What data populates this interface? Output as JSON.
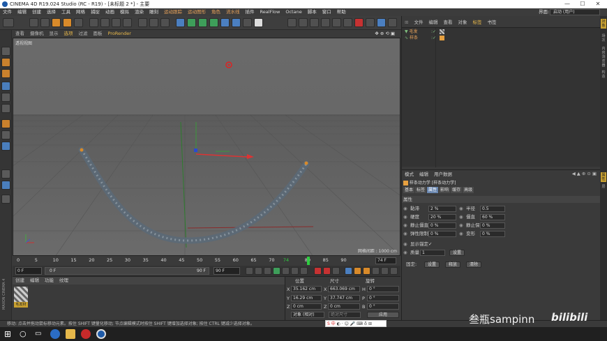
{
  "window": {
    "title": "CINEMA 4D R19.024 Studio (RC - R19) - [未标题 2 *] - 主要",
    "minimize": "—",
    "maximize": "☐",
    "close": "✕"
  },
  "menubar": {
    "items": [
      "文件",
      "编辑",
      "创建",
      "选择",
      "工具",
      "网格",
      "捕捉",
      "动画",
      "模拟",
      "渲染",
      "雕刻",
      "运动跟踪",
      "运动图形",
      "角色",
      "流水线",
      "插件",
      "RealFlow",
      "Octane",
      "脚本",
      "窗口",
      "帮助"
    ],
    "layout_label": "界面:",
    "layout_value": "启动 (用户)"
  },
  "viewport": {
    "menu": [
      "查看",
      "摄像机",
      "显示",
      "选项",
      "过滤",
      "面板",
      "ProRender"
    ],
    "active_menu": "ProRender",
    "label": "透视视图",
    "grid_info": "网格间距 : 1000 cm"
  },
  "timeline": {
    "ticks": [
      "0",
      "5",
      "10",
      "15",
      "20",
      "25",
      "30",
      "35",
      "40",
      "45",
      "50",
      "55",
      "60",
      "65",
      "70",
      "74",
      "80",
      "85",
      "90"
    ],
    "current_frame": "74 F"
  },
  "playbar": {
    "start": "0 F",
    "slider_start": "0 F",
    "slider_end": "90 F",
    "end": "90 F"
  },
  "material_panel": {
    "menu": [
      "创建",
      "编辑",
      "功能",
      "纹理"
    ],
    "material_label": "毛发材"
  },
  "coords": {
    "headers": [
      "位置",
      "尺寸",
      "旋转"
    ],
    "rows": [
      {
        "axis": "X",
        "pos": "35.162 cm",
        "size_axis": "X",
        "size": "663.069 cm",
        "rot_axis": "H",
        "rot": "0 °"
      },
      {
        "axis": "Y",
        "pos": "16.29 cm",
        "size_axis": "Y",
        "size": "37.747 cm",
        "rot_axis": "P",
        "rot": "0 °"
      },
      {
        "axis": "Z",
        "pos": "0 cm",
        "size_axis": "Z",
        "size": "0 cm",
        "rot_axis": "B",
        "rot": "0 °"
      }
    ],
    "mode1": "对象 (相对)",
    "mode2": "绝对尺寸",
    "apply": "应用"
  },
  "object_manager": {
    "menu": [
      "文件",
      "编辑",
      "查看",
      "对象",
      "标签",
      "书签"
    ],
    "objects": [
      {
        "name": "毛发"
      },
      {
        "name": "样条"
      }
    ]
  },
  "attributes": {
    "menu": [
      "模式",
      "编辑",
      "用户数据"
    ],
    "title": "样条动力学 [样条动力学]",
    "tabs": [
      "基本",
      "标签",
      "属性",
      "影响",
      "缓存",
      "高级"
    ],
    "active_tab": "属性",
    "section": "属性",
    "fields": [
      {
        "label": "黏滞",
        "value": "2 %",
        "label2": "半径",
        "value2": "0.5"
      },
      {
        "label": "硬度",
        "value": "20 %",
        "label2": "僵直",
        "value2": "60 %"
      },
      {
        "label": "静止僵直",
        "value": "0 %",
        "label2": "静止保持",
        "value2": "0 %"
      },
      {
        "label": "弹性限制",
        "value": "0 %",
        "label2": "变形",
        "value2": "0 %"
      }
    ],
    "show_anchor": "显示锚定",
    "show_anchor_check": "✓",
    "anchor_label": "质量",
    "anchor_value": "1",
    "set_button": "设置",
    "fix_label": "固定:",
    "fix_set": "设置",
    "fix_release": "释放",
    "fix_clear": "清除"
  },
  "side_tabs": [
    "对象",
    "场次",
    "内容浏览器",
    "构造"
  ],
  "side_tabs_bottom": [
    "属性",
    "层"
  ],
  "statusbar": "移动: 点击并拖动鼠标移动元素。按住 SHIFT 键量化移动; 节点编辑模式时按住 SHIFT 键增加选择对象; 按住 CTRL 键减少选择对象。",
  "watermark": "叁瓶sampinn",
  "bili": "bilibili",
  "maxon": "MAXON CINEMA 4D",
  "ime": "S 中"
}
